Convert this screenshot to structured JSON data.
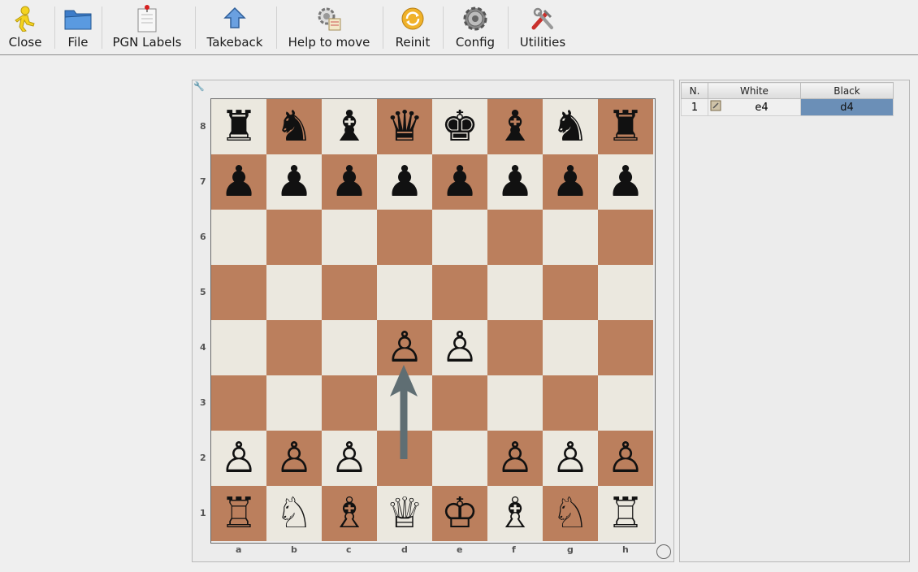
{
  "toolbar": {
    "buttons": [
      {
        "label": "Close",
        "icon": "close-runner-icon"
      },
      {
        "label": "File",
        "icon": "folder-icon"
      },
      {
        "label": "PGN Labels",
        "icon": "pgn-labels-icon"
      },
      {
        "label": "Takeback",
        "icon": "takeback-arrow-icon"
      },
      {
        "label": "Help to move",
        "icon": "help-to-move-icon"
      },
      {
        "label": "Reinit",
        "icon": "reinit-icon"
      },
      {
        "label": "Config",
        "icon": "gear-icon"
      },
      {
        "label": "Utilities",
        "icon": "tools-icon"
      }
    ]
  },
  "board": {
    "files": [
      "a",
      "b",
      "c",
      "d",
      "e",
      "f",
      "g",
      "h"
    ],
    "ranks": [
      "8",
      "7",
      "6",
      "5",
      "4",
      "3",
      "2",
      "1"
    ],
    "position": [
      [
        "r",
        "n",
        "b",
        "q",
        "k",
        "b",
        "n",
        "r"
      ],
      [
        "p",
        "p",
        "p",
        "p",
        "p",
        "p",
        "p",
        "p"
      ],
      [
        "",
        "",
        "",
        "",
        "",
        "",
        "",
        ""
      ],
      [
        "",
        "",
        "",
        "",
        "",
        "",
        "",
        ""
      ],
      [
        "",
        "",
        "",
        "P",
        "P",
        "",
        "",
        ""
      ],
      [
        "",
        "",
        "",
        "",
        "",
        "",
        "",
        ""
      ],
      [
        "P",
        "P",
        "P",
        "",
        "",
        "P",
        "P",
        "P"
      ],
      [
        "R",
        "N",
        "B",
        "Q",
        "K",
        "B",
        "N",
        "R"
      ]
    ],
    "arrow": {
      "from": "d2",
      "to": "d4",
      "color": "#5f6e73"
    },
    "light_color": "#ebe8df",
    "dark_color": "#bb7f5d"
  },
  "moves": {
    "headers": {
      "num": "N.",
      "white": "White",
      "black": "Black"
    },
    "rows": [
      {
        "num": "1",
        "white": "e4",
        "black": "d4"
      }
    ],
    "selected_color": "#6b8fb7"
  }
}
